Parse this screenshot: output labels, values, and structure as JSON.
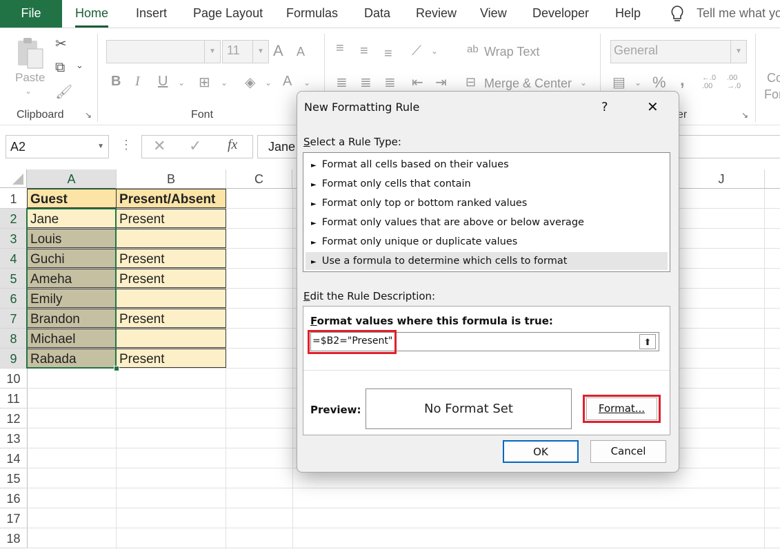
{
  "ribbon_tabs": [
    "File",
    "Home",
    "Insert",
    "Page Layout",
    "Formulas",
    "Data",
    "Review",
    "View",
    "Developer",
    "Help"
  ],
  "tell_me": "Tell me what yo",
  "clipboard": {
    "paste_label": "Paste",
    "group_label": "Clipboard"
  },
  "font": {
    "font_size": "11",
    "group_label": "Font",
    "bold": "B",
    "italic": "I",
    "underline": "U",
    "grow": "A",
    "shrink": "A",
    "color_a": "A"
  },
  "alignment": {
    "wrap_text": "Wrap Text",
    "merge_center": "Merge & Center"
  },
  "number": {
    "format": "General",
    "group_label_fragment": "er",
    "percent": "%",
    "comma": ",",
    "inc_decimal": "←.0\n.00",
    "dec_decimal": ".00\n→.0"
  },
  "styles_fragment": {
    "line1": "Co",
    "line2": "For"
  },
  "formula_bar": {
    "name_box": "A2",
    "formula_value": "Jane",
    "cancel": "✕",
    "enter": "✓",
    "fx": "fx"
  },
  "columns": [
    "A",
    "B",
    "C",
    "J"
  ],
  "rows": [
    "1",
    "2",
    "3",
    "4",
    "5",
    "6",
    "7",
    "8",
    "9",
    "10",
    "11",
    "12",
    "13",
    "14",
    "15",
    "16",
    "17",
    "18"
  ],
  "table": {
    "header": [
      "Guest",
      "Present/Absent"
    ],
    "rows": [
      [
        "Jane",
        "Present"
      ],
      [
        "Louis",
        ""
      ],
      [
        "Guchi",
        "Present"
      ],
      [
        "Ameha",
        "Present"
      ],
      [
        "Emily",
        ""
      ],
      [
        "Brandon",
        "Present"
      ],
      [
        "Michael",
        ""
      ],
      [
        "Rabada",
        "Present"
      ]
    ]
  },
  "dialog": {
    "title": "New Formatting Rule",
    "help": "?",
    "close": "✕",
    "select_rule_type_label": "Select a Rule Type:",
    "rule_types": [
      "Format all cells based on their values",
      "Format only cells that contain",
      "Format only top or bottom ranked values",
      "Format only values that are above or below average",
      "Format only unique or duplicate values",
      "Use a formula to determine which cells to format"
    ],
    "rule_bullet": "►",
    "edit_desc_label": "Edit the Rule Description:",
    "formula_label": "Format values where this formula is true:",
    "formula_value": "=$B2=\"Present\"",
    "preview_label": "Preview:",
    "preview_text": "No Format Set",
    "format_button": "Format...",
    "ok_button": "OK",
    "cancel_button": "Cancel"
  },
  "colors": {
    "excel_green": "#217346",
    "header_fill": "#fce4a6",
    "cell_fill_b": "#fdf0c8",
    "cell_fill_a_selected": "#c6c0a2",
    "highlight_red": "#e0202d"
  }
}
